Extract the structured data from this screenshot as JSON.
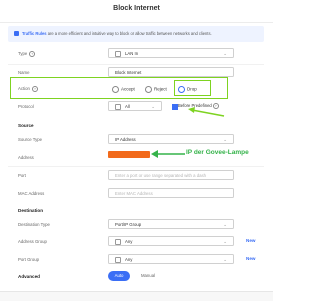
{
  "dialog": {
    "title": "Block Internet"
  },
  "info": {
    "link": "Traffic Rules",
    "text": " are a more efficient and intuitive way to block or allow traffic between networks and clients."
  },
  "fields": {
    "type": {
      "label": "Type",
      "value": "LAN In"
    },
    "name": {
      "label": "Name",
      "value": "Block Internet"
    },
    "action": {
      "label": "Action",
      "options": [
        "Accept",
        "Reject",
        "Drop"
      ],
      "selected": "Drop"
    },
    "protocol": {
      "label": "Protocol",
      "value": "All",
      "checkbox_label": "Before Predefined"
    }
  },
  "source": {
    "section_label": "Source",
    "source_type": {
      "label": "Source Type",
      "value": "IP Address"
    },
    "address": {
      "label": "Address"
    },
    "port": {
      "label": "Port",
      "placeholder": "Enter a port or use range separated with a dash"
    },
    "mac": {
      "label": "MAC Address",
      "placeholder": "Enter MAC Address"
    }
  },
  "destination": {
    "section_label": "Destination",
    "destination_type": {
      "label": "Destination Type",
      "value": "Port/IP Group"
    },
    "address_group": {
      "label": "Address Group",
      "value": "Any",
      "new_label": "New"
    },
    "port_group": {
      "label": "Port Group",
      "value": "Any",
      "new_label": "New"
    }
  },
  "advanced": {
    "label": "Advanced",
    "options": [
      "Auto",
      "Manual"
    ],
    "selected": "Auto"
  },
  "annotation": {
    "text": "IP der Govee-Lampe",
    "color": "#35b34a"
  },
  "colors": {
    "accent": "#3b6ef5",
    "highlight": "#7ed321",
    "redaction": "#f26a1b"
  }
}
